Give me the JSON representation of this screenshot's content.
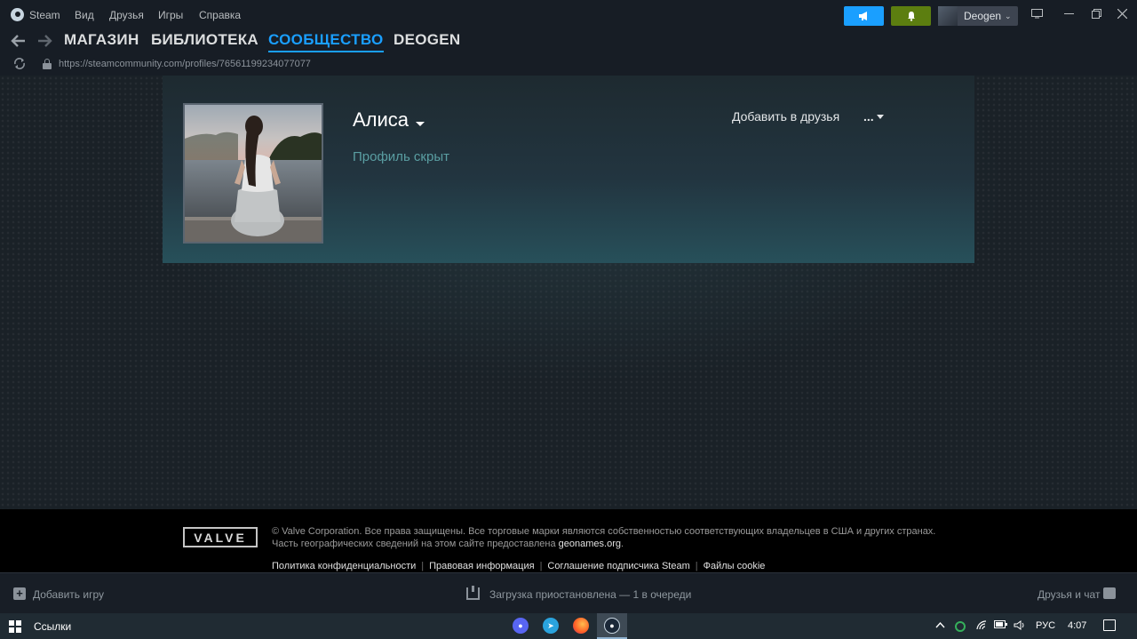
{
  "menubar": {
    "app_name": "Steam",
    "items": [
      "Вид",
      "Друзья",
      "Игры",
      "Справка"
    ],
    "account_name": "Deogen"
  },
  "nav": {
    "links": [
      "МАГАЗИН",
      "БИБЛИОТЕКА",
      "СООБЩЕСТВО",
      "DEOGEN"
    ],
    "active_index": 2
  },
  "url": "https://steamcommunity.com/profiles/76561199234077077",
  "profile": {
    "persona_name": "Алиса",
    "status": "Профиль скрыт",
    "add_friend_label": "Добавить в друзья",
    "more_label": "..."
  },
  "footer": {
    "logo_text": "VALVE",
    "legal_line1": "© Valve Corporation. Все права защищены. Все торговые марки являются собственностью соответствующих владельцев в США и других странах.",
    "legal_line2_prefix": "Часть географических сведений на этом сайте предоставлена ",
    "legal_link": "geonames.org",
    "legal_line2_suffix": ".",
    "links": [
      "Политика конфиденциальности",
      "Правовая информация",
      "Соглашение подписчика Steam",
      "Файлы cookie"
    ]
  },
  "statusbar": {
    "add_game": "Добавить игру",
    "download_status": "Загрузка приостановлена — 1 в очереди",
    "friends_chat": "Друзья и чат"
  },
  "taskbar": {
    "links_label": "Ссылки",
    "language": "РУС",
    "time": "4:07"
  },
  "colors": {
    "accent_blue": "#1a9fff",
    "notify_green": "#5c7e10",
    "private_text": "#5a9ea2"
  }
}
